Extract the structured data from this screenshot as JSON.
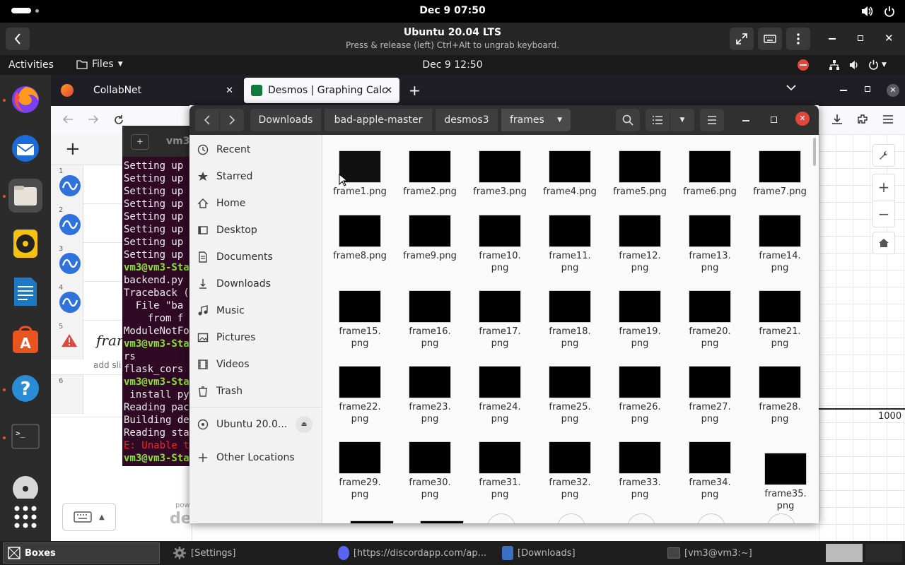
{
  "host": {
    "clock": "Dec 9  07:50"
  },
  "vm": {
    "title": "Ubuntu 20.04 LTS",
    "subtitle": "Press & release (left) Ctrl+Alt to ungrab keyboard."
  },
  "guest": {
    "activities": "Activities",
    "app_menu": "Files",
    "clock": "Dec 9  12:50"
  },
  "firefox": {
    "tabs": [
      {
        "label": "CollabNet"
      },
      {
        "label": "Desmos | Graphing Calcu"
      }
    ]
  },
  "desmos": {
    "rows": [
      "1",
      "2",
      "3",
      "4",
      "5",
      "6"
    ],
    "expr5": "fran",
    "add_slider": "add sli",
    "axis_label": "1000",
    "powered_short": "pow",
    "brand_short": "de"
  },
  "terminal": {
    "title": "vm3",
    "lines": [
      "Setting up",
      "Setting up",
      "Setting up",
      "Setting up",
      "Setting up",
      "Setting up",
      "Setting up",
      "Setting up",
      "vm3@vm3-Sta",
      "backend.py",
      "Traceback (",
      "  File \"ba",
      "    from f",
      "ModuleNotFo",
      "vm3@vm3-Sta",
      "rs",
      "flask_cors",
      "vm3@vm3-Sta",
      " install py",
      "Reading pac",
      "Building de",
      "Reading sta",
      "E: Unable t",
      "vm3@vm3-Sta"
    ]
  },
  "files": {
    "breadcrumbs": [
      "Downloads",
      "bad-apple-master",
      "desmos3",
      "frames"
    ],
    "sidebar": [
      {
        "label": "Recent",
        "icon": "clock-icon"
      },
      {
        "label": "Starred",
        "icon": "star-icon"
      },
      {
        "label": "Home",
        "icon": "home-icon"
      },
      {
        "label": "Desktop",
        "icon": "desktop-icon"
      },
      {
        "label": "Documents",
        "icon": "document-icon"
      },
      {
        "label": "Downloads",
        "icon": "download-icon"
      },
      {
        "label": "Music",
        "icon": "music-icon"
      },
      {
        "label": "Pictures",
        "icon": "picture-icon"
      },
      {
        "label": "Videos",
        "icon": "video-icon"
      },
      {
        "label": "Trash",
        "icon": "trash-icon"
      },
      {
        "label": "Ubuntu 20.0...",
        "icon": "disk-icon"
      },
      {
        "label": "Other Locations",
        "icon": "plus-icon"
      }
    ],
    "items": [
      {
        "l1": "frame1.png",
        "l2": ""
      },
      {
        "l1": "frame2.png",
        "l2": ""
      },
      {
        "l1": "frame3.png",
        "l2": ""
      },
      {
        "l1": "frame4.png",
        "l2": ""
      },
      {
        "l1": "frame5.png",
        "l2": ""
      },
      {
        "l1": "frame6.png",
        "l2": ""
      },
      {
        "l1": "frame7.png",
        "l2": ""
      },
      {
        "l1": "frame8.png",
        "l2": ""
      },
      {
        "l1": "frame9.png",
        "l2": ""
      },
      {
        "l1": "frame10.",
        "l2": "png"
      },
      {
        "l1": "frame11.",
        "l2": "png"
      },
      {
        "l1": "frame12.",
        "l2": "png"
      },
      {
        "l1": "frame13.",
        "l2": "png"
      },
      {
        "l1": "frame14.",
        "l2": "png"
      },
      {
        "l1": "frame15.",
        "l2": "png"
      },
      {
        "l1": "frame16.",
        "l2": "png"
      },
      {
        "l1": "frame17.",
        "l2": "png"
      },
      {
        "l1": "frame18.",
        "l2": "png"
      },
      {
        "l1": "frame19.",
        "l2": "png"
      },
      {
        "l1": "frame20.",
        "l2": "png"
      },
      {
        "l1": "frame21.",
        "l2": "png"
      },
      {
        "l1": "frame22.",
        "l2": "png"
      },
      {
        "l1": "frame23.",
        "l2": "png"
      },
      {
        "l1": "frame24.",
        "l2": "png"
      },
      {
        "l1": "frame25.",
        "l2": "png"
      },
      {
        "l1": "frame26.",
        "l2": "png"
      },
      {
        "l1": "frame27.",
        "l2": "png"
      },
      {
        "l1": "frame28.",
        "l2": "png"
      },
      {
        "l1": "frame29.",
        "l2": "png"
      },
      {
        "l1": "frame30.",
        "l2": "png"
      },
      {
        "l1": "frame31.",
        "l2": "png"
      },
      {
        "l1": "frame32.",
        "l2": "png"
      },
      {
        "l1": "frame33.",
        "l2": "png"
      },
      {
        "l1": "frame34.",
        "l2": "png"
      },
      {
        "l1": "frame35.",
        "l2": "png"
      }
    ]
  },
  "taskbar": [
    {
      "label": "Boxes"
    },
    {
      "label": "[Settings]"
    },
    {
      "label": "[https://discordapp.com/ap..."
    },
    {
      "label": "[Downloads]"
    },
    {
      "label": "[vm3@vm3:~]"
    }
  ],
  "colors": {
    "terminal_bg": "#300a24",
    "close_red": "#e0463b",
    "desmos_blue": "#2f72dc",
    "prompt_green": "#8ae234"
  }
}
